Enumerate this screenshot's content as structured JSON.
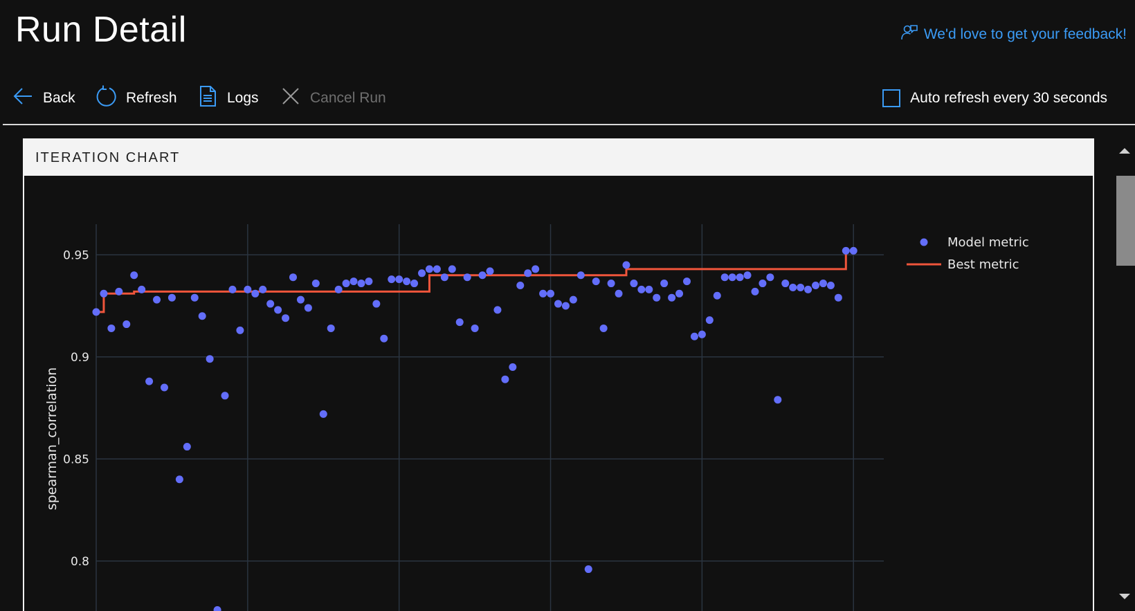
{
  "header": {
    "title": "Run Detail",
    "feedback_label": "We'd love to get your feedback!",
    "feedback_icon": "feedback-person-icon"
  },
  "toolbar": {
    "back_label": "Back",
    "refresh_label": "Refresh",
    "logs_label": "Logs",
    "cancel_label": "Cancel Run",
    "auto_refresh_label": "Auto refresh every 30 seconds",
    "auto_refresh_checked": false
  },
  "panel": {
    "title": "ITERATION CHART"
  },
  "colors": {
    "background": "#111111",
    "accent": "#3b9bf5",
    "model_metric": "#636efa",
    "best_metric": "#ef553b",
    "grid": "#2a3440"
  },
  "chart_data": {
    "type": "scatter",
    "ylabel": "spearman_correlation",
    "xlabel": "",
    "ylim": [
      0.765,
      0.965
    ],
    "xlim": [
      0,
      104
    ],
    "yticks": [
      0.8,
      0.85,
      0.9,
      0.95
    ],
    "ytick_labels": [
      "0.8",
      "0.85",
      "0.9",
      "0.95"
    ],
    "x_gridlines": [
      0,
      20,
      40,
      60,
      80,
      100
    ],
    "grid": true,
    "legend_position": "top-right",
    "series": [
      {
        "name": "Model metric",
        "type": "scatter",
        "x": [
          0,
          1,
          2,
          3,
          4,
          5,
          6,
          7,
          8,
          9,
          10,
          11,
          12,
          13,
          14,
          15,
          16,
          17,
          18,
          19,
          20,
          21,
          22,
          23,
          24,
          25,
          26,
          27,
          28,
          29,
          30,
          31,
          32,
          33,
          34,
          35,
          36,
          37,
          38,
          39,
          40,
          41,
          42,
          43,
          44,
          45,
          46,
          47,
          48,
          49,
          50,
          51,
          52,
          53,
          54,
          55,
          56,
          57,
          58,
          59,
          60,
          61,
          62,
          63,
          64,
          65,
          66,
          67,
          68,
          69,
          70,
          71,
          72,
          73,
          74,
          75,
          76,
          77,
          78,
          79,
          80,
          81,
          82,
          83,
          84,
          85,
          86,
          87,
          88,
          89,
          90,
          91,
          92,
          93,
          94,
          95,
          96,
          97,
          98,
          99,
          100
        ],
        "y": [
          0.922,
          0.931,
          0.914,
          0.932,
          0.916,
          0.94,
          0.933,
          0.888,
          0.928,
          0.885,
          0.929,
          0.84,
          0.856,
          0.929,
          0.92,
          0.899,
          0.776,
          0.881,
          0.933,
          0.913,
          0.933,
          0.931,
          0.933,
          0.926,
          0.923,
          0.919,
          0.939,
          0.928,
          0.924,
          0.936,
          0.872,
          0.914,
          0.933,
          0.936,
          0.937,
          0.936,
          0.937,
          0.926,
          0.909,
          0.938,
          0.938,
          0.937,
          0.936,
          0.941,
          0.943,
          0.943,
          0.939,
          0.943,
          0.917,
          0.939,
          0.914,
          0.94,
          0.942,
          0.923,
          0.889,
          0.895,
          0.935,
          0.941,
          0.943,
          0.931,
          0.931,
          0.926,
          0.925,
          0.928,
          0.94,
          0.796,
          0.937,
          0.914,
          0.936,
          0.931,
          0.945,
          0.936,
          0.933,
          0.933,
          0.929,
          0.936,
          0.929,
          0.931,
          0.937,
          0.91,
          0.911,
          0.918,
          0.93,
          0.939,
          0.939,
          0.939,
          0.94,
          0.932,
          0.936,
          0.939,
          0.879,
          0.936,
          0.934,
          0.934,
          0.933,
          0.935,
          0.936,
          0.935,
          0.929,
          0.952,
          0.952
        ]
      },
      {
        "name": "Best metric",
        "type": "step",
        "x": [
          0,
          1,
          5,
          44,
          70,
          99
        ],
        "y": [
          0.922,
          0.931,
          0.932,
          0.94,
          0.943,
          0.945
        ]
      }
    ]
  }
}
